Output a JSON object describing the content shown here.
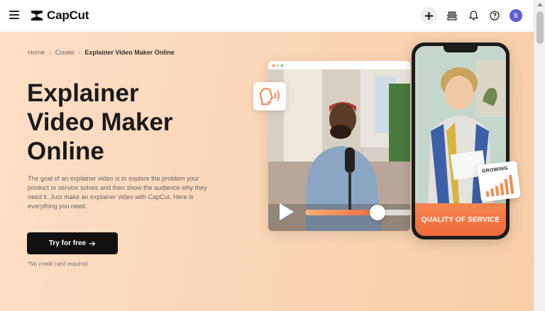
{
  "app": {
    "brand": "CapCut"
  },
  "topbar": {
    "icons": [
      "menu-icon",
      "plus-icon",
      "layers-icon",
      "bell-icon",
      "help-icon"
    ],
    "avatar_initial": "B",
    "colors": {
      "avatar": "#5b5bd6"
    }
  },
  "breadcrumb": {
    "home": "Home",
    "create": "Create",
    "current": "Explainer Video Maker Online"
  },
  "hero": {
    "title": "Explainer Video Maker Online",
    "description": "The goal of an explainer video is to explore the problem your product or service solves and then show the audience why they need it. Just make an explainer video with CapCut. Here is everything you need.",
    "cta_label": "Try for free",
    "note": "*No credit card required",
    "colors": {
      "background": "#fbd6b8",
      "cta": "#111111",
      "accent": "#f06a3b"
    }
  },
  "media": {
    "video_progress": 0.68,
    "quality_label": "QUALITY OF SERVICE",
    "growing_label": "GROWING"
  }
}
